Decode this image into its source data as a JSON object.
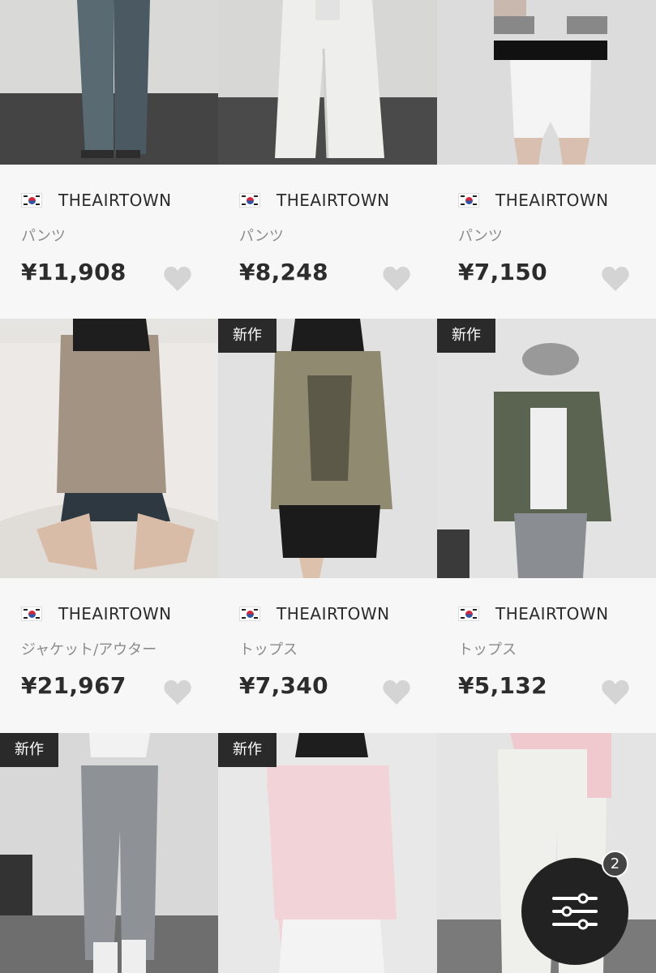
{
  "products": [
    {
      "brand": "THEAIRTOWN",
      "category": "パンツ",
      "price": "¥11,908",
      "badge": ""
    },
    {
      "brand": "THEAIRTOWN",
      "category": "パンツ",
      "price": "¥8,248",
      "badge": ""
    },
    {
      "brand": "THEAIRTOWN",
      "category": "パンツ",
      "price": "¥7,150",
      "badge": ""
    },
    {
      "brand": "THEAIRTOWN",
      "category": "ジャケット/アウター",
      "price": "¥21,967",
      "badge": ""
    },
    {
      "brand": "THEAIRTOWN",
      "category": "トップス",
      "price": "¥7,340",
      "badge": "新作"
    },
    {
      "brand": "THEAIRTOWN",
      "category": "トップス",
      "price": "¥5,132",
      "badge": "新作"
    },
    {
      "badge": "新作"
    },
    {
      "badge": "新作"
    },
    {
      "badge": ""
    }
  ],
  "filter_button": {
    "count": "2",
    "icon": "sliders-icon"
  },
  "colors": {
    "heart": "#d4d4d4",
    "badge_bg": "#2a2a2a",
    "fab_bg": "#222222"
  }
}
